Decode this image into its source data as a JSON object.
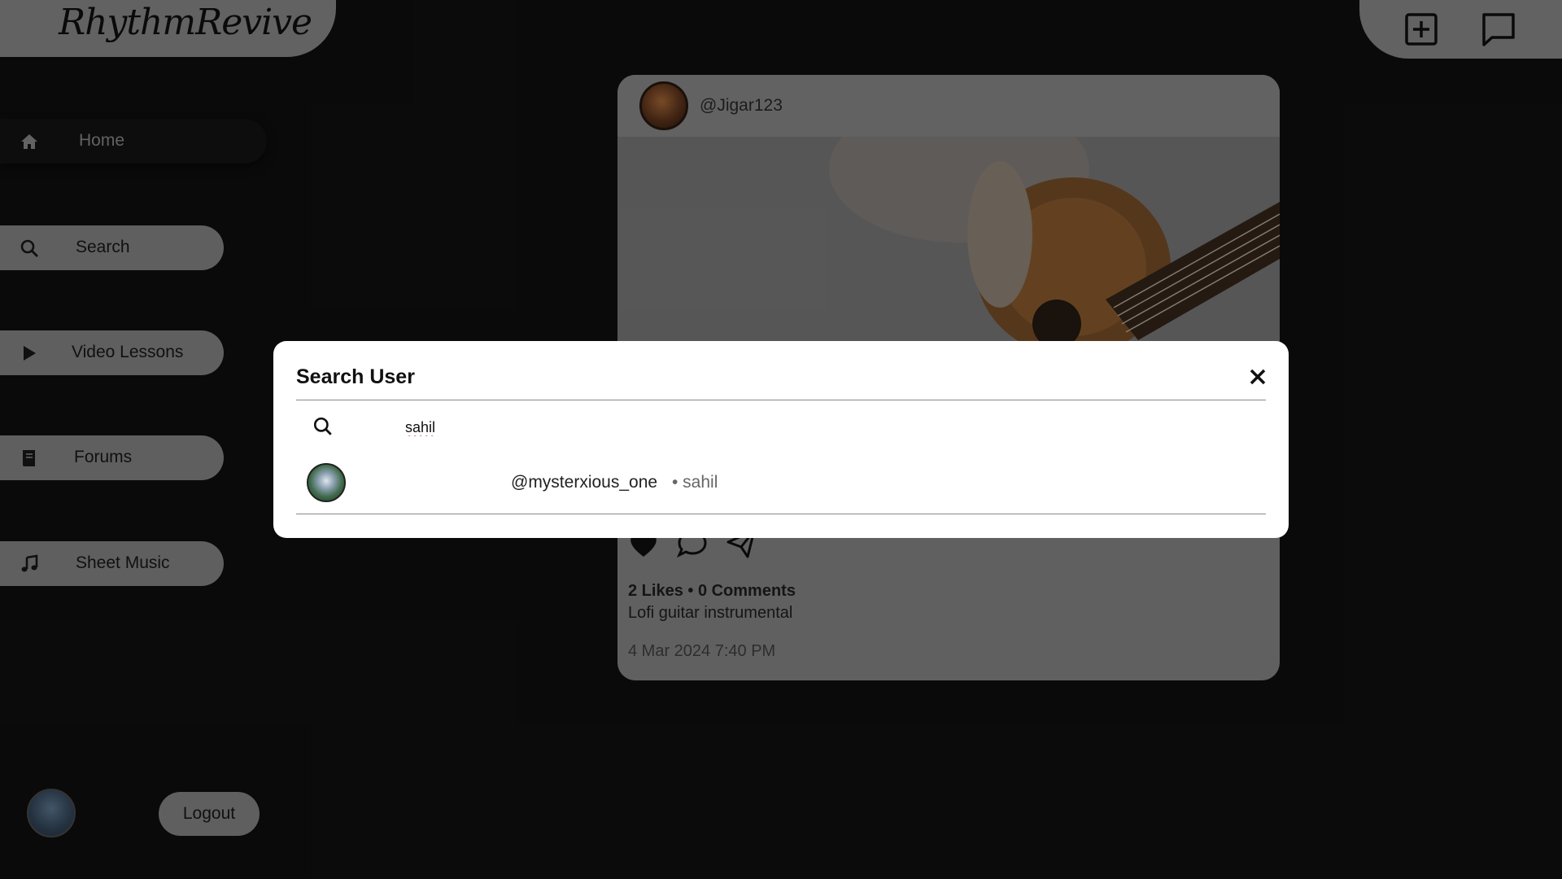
{
  "app": {
    "logo_text": "RhythmRevive"
  },
  "sidebar": {
    "items": [
      {
        "label": "Home",
        "icon": "home-icon"
      },
      {
        "label": "Search",
        "icon": "search-icon"
      },
      {
        "label": "Video Lessons",
        "icon": "play-icon"
      },
      {
        "label": "Forums",
        "icon": "book-icon"
      },
      {
        "label": "Sheet Music",
        "icon": "music-note-icon"
      }
    ],
    "logout_label": "Logout"
  },
  "topbar": {
    "icons": [
      "add-post-icon",
      "chat-icon"
    ]
  },
  "post": {
    "username": "@Jigar123",
    "likes_comments": "2 Likes • 0 Comments",
    "caption": "Lofi guitar instrumental",
    "date": "4 Mar 2024 7:40 PM"
  },
  "search_modal": {
    "title": "Search User",
    "query": "sahil",
    "results": [
      {
        "handle": "@mysterxious_one",
        "name": "• sahil"
      }
    ]
  }
}
